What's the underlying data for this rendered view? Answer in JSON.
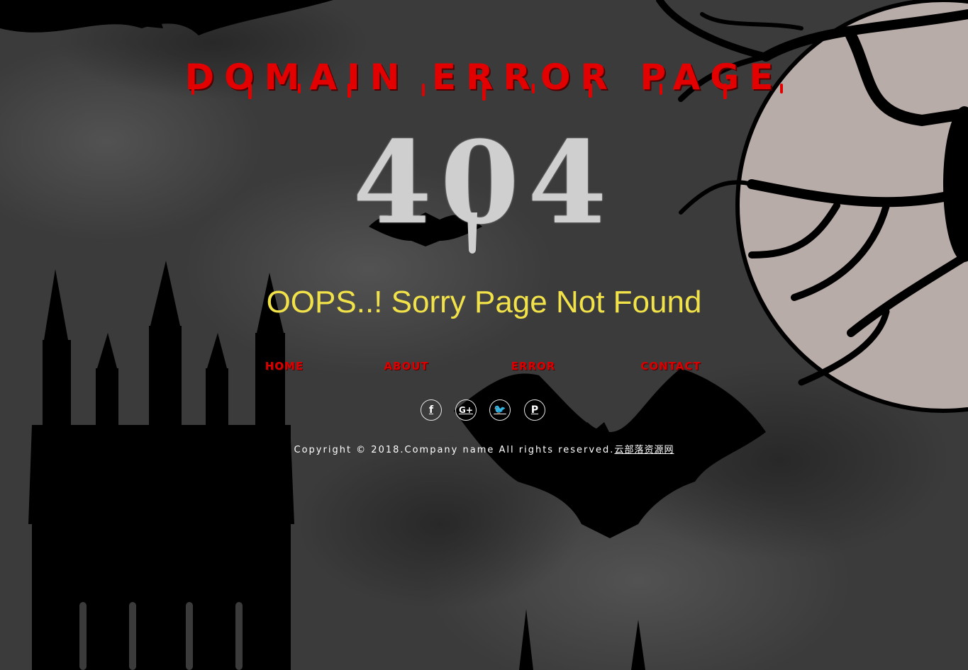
{
  "header": {
    "title": "DOMAIN ERROR PAGE"
  },
  "error": {
    "code": "404",
    "message": "OOPS..! Sorry Page Not Found"
  },
  "nav": {
    "home": "HOME",
    "about": "ABOUT",
    "error": "ERROR",
    "contact": "CONTACT"
  },
  "social": [
    {
      "name": "facebook-icon",
      "glyph": "f"
    },
    {
      "name": "google-plus-icon",
      "glyph": "G+"
    },
    {
      "name": "twitter-icon",
      "glyph": "🐦"
    },
    {
      "name": "pinterest-icon",
      "glyph": "P"
    }
  ],
  "footer": {
    "copyright": "Copyright © 2018.Company name All rights reserved.",
    "link_text": "云部落资源网"
  },
  "colors": {
    "title": "#e30000",
    "code": "#cfcfcf",
    "message": "#f2e24a",
    "nav": "#d80000",
    "background": "#3a3a3a",
    "moon": "#b8aca8"
  }
}
